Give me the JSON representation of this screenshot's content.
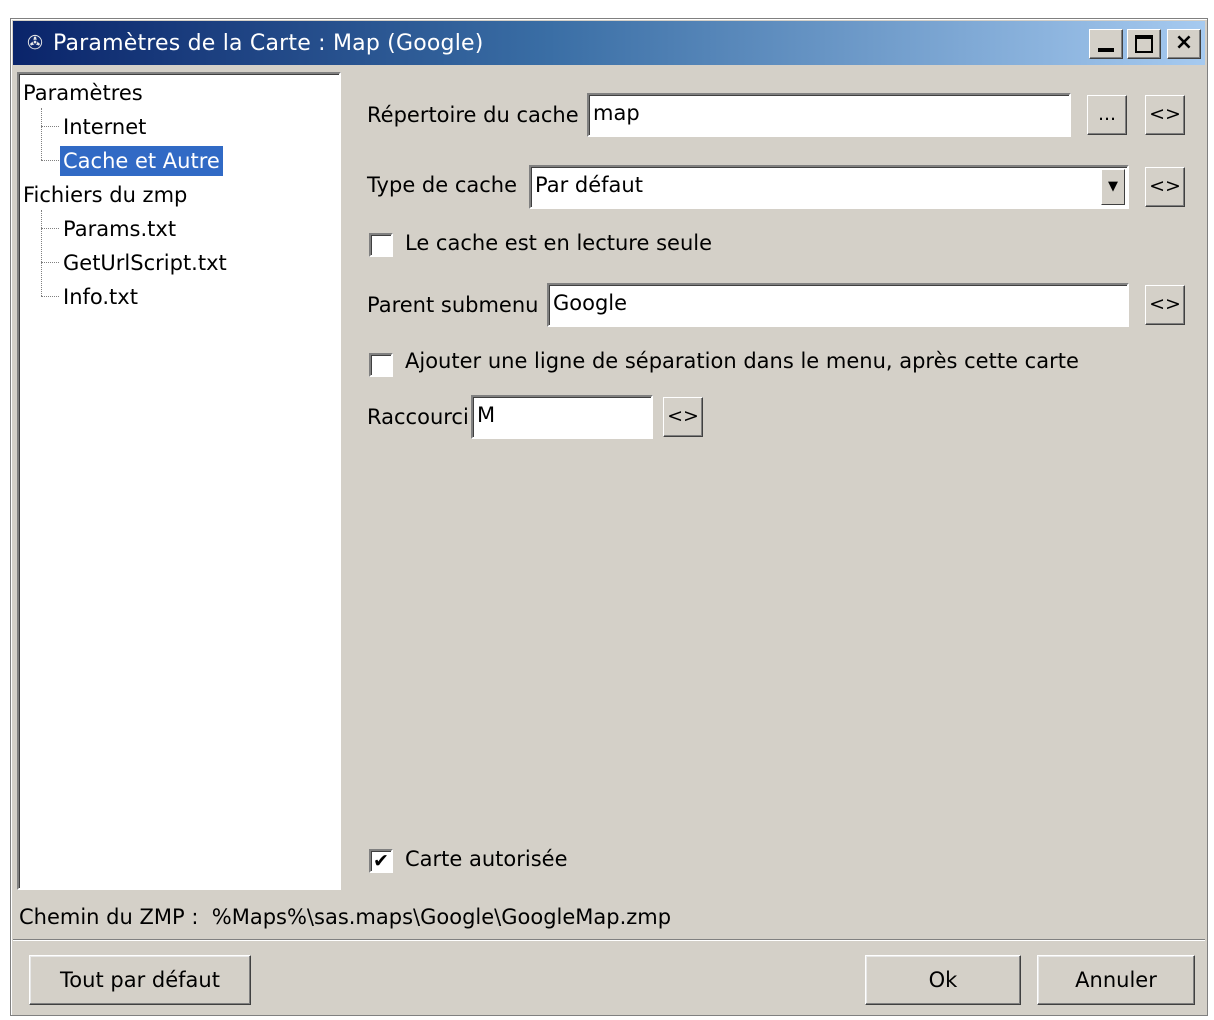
{
  "window": {
    "title": "Paramètres de la Carte : Map (Google)",
    "icon": "app-icon",
    "controls": {
      "minimize": "minimize-icon",
      "maximize": "maximize-icon",
      "close": "×"
    }
  },
  "tree": {
    "groups": [
      {
        "label": "Paramètres",
        "children": [
          "Internet",
          "Cache et Autre"
        ]
      },
      {
        "label": "Fichiers du zmp",
        "children": [
          "Params.txt",
          "GetUrlScript.txt",
          "Info.txt"
        ]
      }
    ],
    "selected": "Cache et Autre"
  },
  "form": {
    "cache_dir_label": "Répertoire du cache",
    "cache_dir_value": "map",
    "browse_label": "...",
    "reset_label": "<>",
    "cache_type_label": "Type de cache",
    "cache_type_value": "Par défaut",
    "readonly_label": "Le cache est en lecture seule",
    "readonly_checked": false,
    "parent_submenu_label": "Parent submenu",
    "parent_submenu_value": "Google",
    "separator_label": "Ajouter une ligne de séparation dans le menu, après cette carte",
    "separator_checked": false,
    "shortcut_label": "Raccourci",
    "shortcut_value": "M",
    "enabled_label": "Carte autorisée",
    "enabled_checked": true,
    "checkmark": "✔"
  },
  "status": {
    "zmp_path_label": "Chemin du ZMP :",
    "zmp_path_value": "%Maps%\\sas.maps\\Google\\GoogleMap.zmp"
  },
  "buttons": {
    "defaults": "Tout par défaut",
    "ok": "Ok",
    "cancel": "Annuler"
  }
}
